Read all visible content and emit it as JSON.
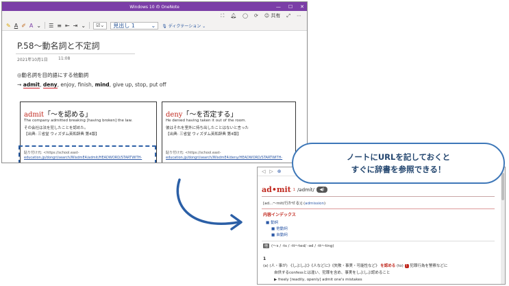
{
  "onenote": {
    "title": "Windows 10 の OneNote",
    "window_controls": [
      "—",
      "☐",
      "✕"
    ],
    "share_label": "共有",
    "ribbon": {
      "style_label": "見出し 1",
      "style_chevron": "⌄",
      "dictation_label": "ディクテーション"
    },
    "page": {
      "title": "P.58〜動名詞と不定詞",
      "date": "2021年10月1日",
      "time": "11:08",
      "line1": "◎動名詞を目的語にする他動詞",
      "line2": {
        "prefix": "→",
        "w1": "admit",
        "sep1": ", ",
        "w2": "deny",
        "rest1": ", enjoy,  finish, ",
        "w3": "mind",
        "rest2": ", give up, stop, put off"
      },
      "cards": [
        {
          "keyword": "admit",
          "meaning": "「〜を認める」",
          "example_en": "The company admitted breaking [having broken] the law.",
          "example_ja": "その会社は法を犯したことを認めた。",
          "source": "【出典: 三省堂 ウィズダム英和辞典 第4版】",
          "ref_label": "貼り付け元: <https://school.east-",
          "ref_url": "education.jp/dongri/search/WisdmE4/admit/HEADWORD/STARTWITH-"
        },
        {
          "keyword": "deny",
          "meaning": "「〜を否定する」",
          "example_en": "He denied having taken it out of the room.",
          "example_ja": "彼はそれを室外に持ち出したことはないと言った",
          "source": "【出典: 三省堂 ウィズダム英和辞典 第4版】",
          "ref_label": "貼り付け元: <https://school.east-",
          "ref_url": "education.jp/dongri/search/WisdmE4/deny/HEADWORD/STARTWITH-"
        }
      ]
    }
  },
  "callout": {
    "line1": "ノートにURLを記しておくと",
    "line2": "すぐに辞書を参照できる！"
  },
  "dictionary": {
    "nav": [
      "◁",
      "▷",
      "⊕"
    ],
    "headword": "ad•mit",
    "superscript": "1",
    "pron": "/ədmít/",
    "speaker_label": "◀)",
    "forms": "[ad...〜mit(行かせる)] (",
    "forms_link": "admission",
    "forms_end": ")",
    "index_title": "内容インデックス",
    "index_items": [
      "動詞",
      "他動詞",
      "自動詞"
    ],
    "sec_tag": "他",
    "sec_text": "(〜s / -ts / -tt〜ted/ -əd / -tt〜ting)",
    "t_mark": "1",
    "sense_num": "(a)",
    "sense_text": "(人・事が) 《しぶしぶ》《人などに》《失敗・事実・可能性など》",
    "sense_red": "を認める",
    "sense_tail": "(to)",
    "sense_badge": "!",
    "sense_tail2": "犯罪行為を警察などに",
    "sense2": "自供するconfessとは違い、犯罪を含め、事実をしぶしぶ認めること",
    "example": "▶ freely [readily, openly] admit one's mistakes"
  }
}
